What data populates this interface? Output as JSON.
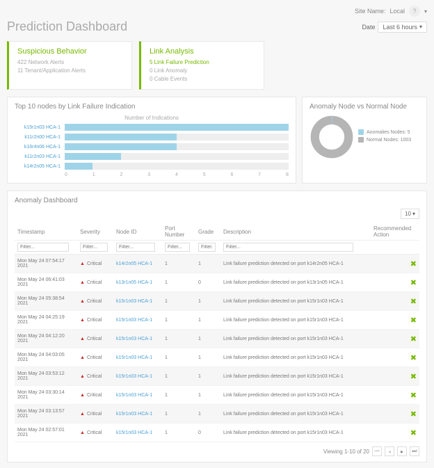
{
  "topbar": {
    "site_label": "Site Name:",
    "site_value": "Local",
    "help": "?"
  },
  "header": {
    "title": "Prediction Dashboard",
    "date_label": "Date",
    "date_value": "Last 6 hours"
  },
  "cards": [
    {
      "title": "Suspicious Behavior",
      "lines": [
        {
          "text": "422 Network Alerts",
          "cls": ""
        },
        {
          "text": "11 Tenant/Application Alerts",
          "cls": ""
        }
      ]
    },
    {
      "title": "Link Analysis",
      "lines": [
        {
          "text": "5 Link Failure Prediction",
          "cls": "green"
        },
        {
          "text": "0 Link Anomaly",
          "cls": ""
        },
        {
          "text": "0 Cable Events",
          "cls": ""
        }
      ]
    }
  ],
  "bar_panel": {
    "title": "Top 10 nodes by Link Failure Indication",
    "subtitle": "Number of Indications"
  },
  "chart_data": {
    "type": "bar",
    "orientation": "horizontal",
    "categories": [
      "k15r1n03 HCA-1",
      "k11r2n00 HCA-1",
      "k16r4n06 HCA-1",
      "k11r2n03 HCA-1",
      "k14r2n05 HCA-1"
    ],
    "values": [
      8,
      4,
      4,
      2,
      1
    ],
    "xlim": [
      0,
      8
    ],
    "xlabel": "Number of Indications",
    "title": "Top 10 nodes by Link Failure Indication",
    "ticks": [
      0,
      1,
      2,
      3,
      4,
      5,
      6,
      7,
      8
    ]
  },
  "donut_panel": {
    "title": "Anomaly Node vs Normal Node"
  },
  "donut_data": {
    "type": "pie",
    "series": [
      {
        "name": "Anomalies Nodes",
        "value": 5
      },
      {
        "name": "Normal Nodes",
        "value": 1003
      }
    ],
    "legend": [
      "Anomalies Nodes: 5",
      "Normal Nodes: 1003"
    ]
  },
  "anomaly": {
    "title": "Anomaly Dashboard",
    "pagesize": "10",
    "columns": [
      "Timestamp",
      "Severity",
      "Node ID",
      "Port Number",
      "Grade",
      "Description",
      "Recommended Action"
    ],
    "filter_placeholder": "Filter...",
    "rows": [
      {
        "ts": "Mon May 24 07:54:17 2021",
        "sev": "Critical",
        "node": "k14r2n05 HCA-1",
        "port": "1",
        "grade": "1",
        "desc": "Link failure prediction detected on port k14r2n05 HCA-1"
      },
      {
        "ts": "Mon May 24 06:41:03 2021",
        "sev": "Critical",
        "node": "k13r1n05 HCA-1",
        "port": "1",
        "grade": "0",
        "desc": "Link failure prediction detected on port k13r1n05 HCA-1"
      },
      {
        "ts": "Mon May 24 05:38:54 2021",
        "sev": "Critical",
        "node": "k15r1n03 HCA-1",
        "port": "1",
        "grade": "1",
        "desc": "Link failure prediction detected on port k15r1n03 HCA-1"
      },
      {
        "ts": "Mon May 24 04:25:19 2021",
        "sev": "Critical",
        "node": "k15r1n03 HCA-1",
        "port": "1",
        "grade": "1",
        "desc": "Link failure prediction detected on port k15r1n03 HCA-1"
      },
      {
        "ts": "Mon May 24 04:12:20 2021",
        "sev": "Critical",
        "node": "k15r1n03 HCA-1",
        "port": "1",
        "grade": "1",
        "desc": "Link failure prediction detected on port k15r1n03 HCA-1"
      },
      {
        "ts": "Mon May 24 04:03:05 2021",
        "sev": "Critical",
        "node": "k15r1n03 HCA-1",
        "port": "1",
        "grade": "1",
        "desc": "Link failure prediction detected on port k15r1n03 HCA-1"
      },
      {
        "ts": "Mon May 24 03:53:12 2021",
        "sev": "Critical",
        "node": "k15r1n03 HCA-1",
        "port": "1",
        "grade": "1",
        "desc": "Link failure prediction detected on port k15r1n03 HCA-1"
      },
      {
        "ts": "Mon May 24 03:30:14 2021",
        "sev": "Critical",
        "node": "k15r1n03 HCA-1",
        "port": "1",
        "grade": "1",
        "desc": "Link failure prediction detected on port k15r1n03 HCA-1"
      },
      {
        "ts": "Mon May 24 03:13:57 2021",
        "sev": "Critical",
        "node": "k15r1n03 HCA-1",
        "port": "1",
        "grade": "1",
        "desc": "Link failure prediction detected on port k15r1n03 HCA-1"
      },
      {
        "ts": "Mon May 24 02:57:01 2021",
        "sev": "Critical",
        "node": "k15r1n03 HCA-1",
        "port": "1",
        "grade": "0",
        "desc": "Link failure prediction detected on port k15r1n03 HCA-1"
      }
    ],
    "pager_text": "Viewing 1-10 of 20"
  }
}
